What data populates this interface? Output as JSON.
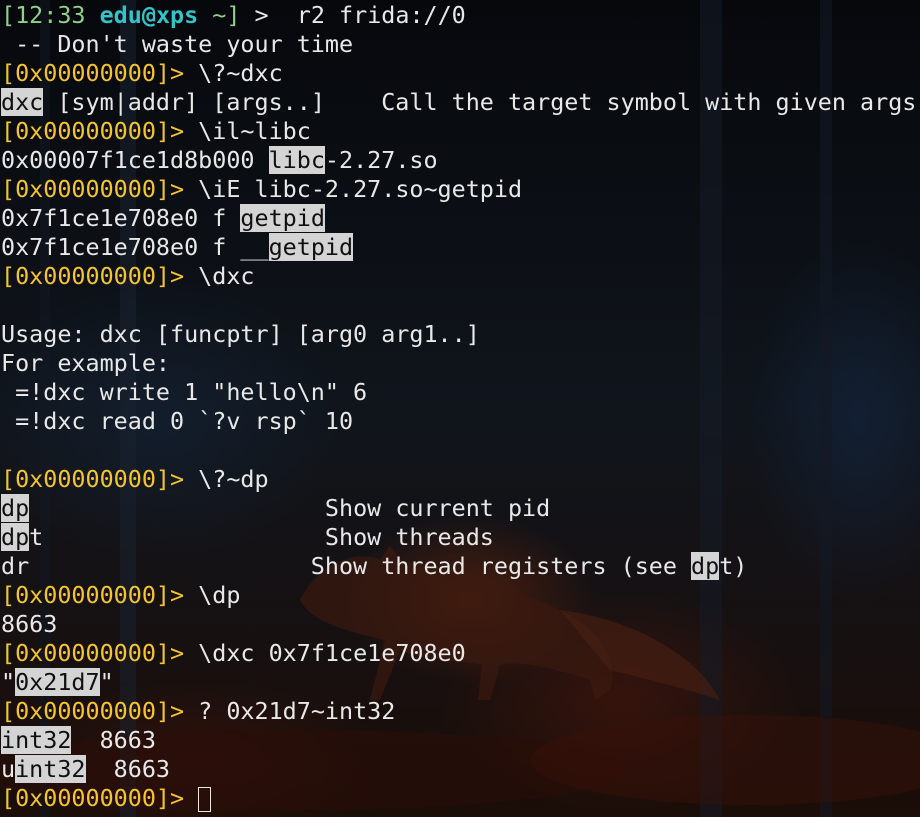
{
  "header": {
    "time": "[12:33",
    "user": "edu",
    "at": "@",
    "host": "xps",
    "path": " ~]",
    "symbol": " >  ",
    "command": "r2 frida://0"
  },
  "motd": " -- Don't waste your time",
  "prompt": "[0x00000000]>",
  "lines": {
    "l2_cmd": " \\?~dxc",
    "l3_hl": "dxc",
    "l3_rest": " [sym|addr] [args..]    Call the target symbol with given args",
    "l4_cmd": " \\il~libc",
    "l5_pre": "0x00007f1ce1d8b000 ",
    "l5_hl": "libc",
    "l5_post": "-2.27.so",
    "l6_cmd": " \\iE libc-2.27.so~getpid",
    "l7_pre": "0x7f1ce1e708e0 f ",
    "l7_hl": "getpid",
    "l8_pre": "0x7f1ce1e708e0 f __",
    "l8_hl": "getpid",
    "l9_cmd": " \\dxc",
    "l11": "Usage: dxc [funcptr] [arg0 arg1..]",
    "l12": "For example:",
    "l13": " =!dxc write 1 \"hello\\n\" 6",
    "l14": " =!dxc read 0 `?v rsp` 10",
    "l16_cmd": " \\?~dp",
    "l17_hl": "dp",
    "l17_rest": "                     Show current pid",
    "l18_hl": "dp",
    "l18_rest": "t                    Show threads",
    "l19_pre": "dr                    Show thread registers (see ",
    "l19_hl": "dp",
    "l19_post": "t)",
    "l20_cmd": " \\dp",
    "l21": "8663",
    "l22_cmd": " \\dxc 0x7f1ce1e708e0",
    "l23_pre": "\"",
    "l23_hl": "0x21d7",
    "l23_post": "\"",
    "l24_cmd": " ? 0x21d7~int32",
    "l25_hl": "int32",
    "l25_rest": "  8663",
    "l26_pre": "u",
    "l26_hl": "int32",
    "l26_rest": "  8663",
    "l27_cmd": " "
  },
  "colors": {
    "prompt": "#f4c431",
    "user": "#36c3c8",
    "highlight_bg": "#d4d4d4",
    "text": "#e8e8e8"
  },
  "icons": {
    "background": "fox-in-forest-wallpaper",
    "cursor": "block-cursor-icon"
  }
}
